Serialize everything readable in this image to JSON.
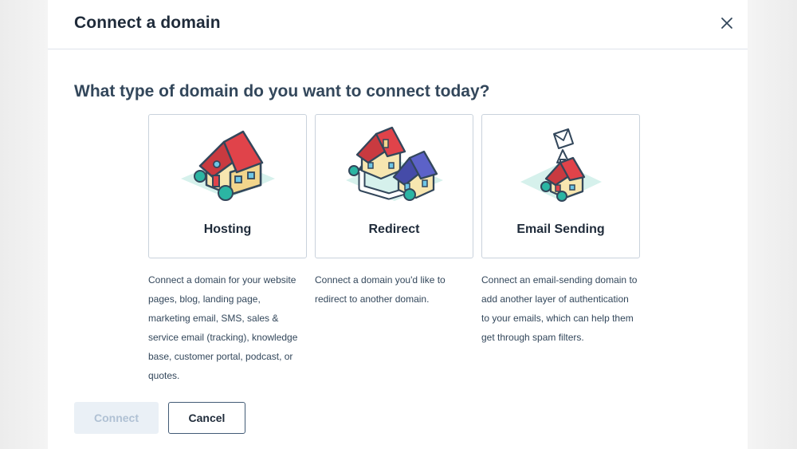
{
  "dialog": {
    "title": "Connect a domain",
    "close_icon": "close-icon"
  },
  "main": {
    "question": "What type of domain do you want to connect today?",
    "options": [
      {
        "label": "Hosting",
        "icon": "house-icon",
        "description": [
          "Connect a domain for your website",
          "pages, blog, landing page,",
          "marketing email, SMS, sales &",
          "service email (tracking), knowledge",
          "base, customer portal, podcast, or",
          "quotes."
        ]
      },
      {
        "label": "Redirect",
        "icon": "redirect-houses-icon",
        "description": [
          "Connect a domain you'd like to",
          "redirect to another domain."
        ]
      },
      {
        "label": "Email Sending",
        "icon": "email-house-icon",
        "description": [
          "Connect an email-sending domain to",
          "add another layer of authentication",
          "to your emails, which can help them",
          "get through spam filters."
        ]
      }
    ]
  },
  "footer": {
    "connect_label": "Connect",
    "cancel_label": "Cancel"
  },
  "colors": {
    "roof_red": "#e0434a",
    "house_wall": "#f7e6b0",
    "house_outline": "#33475b",
    "ground": "#d6f1ec",
    "bush": "#2bb5a3",
    "roof_blue": "#5c62c8"
  }
}
